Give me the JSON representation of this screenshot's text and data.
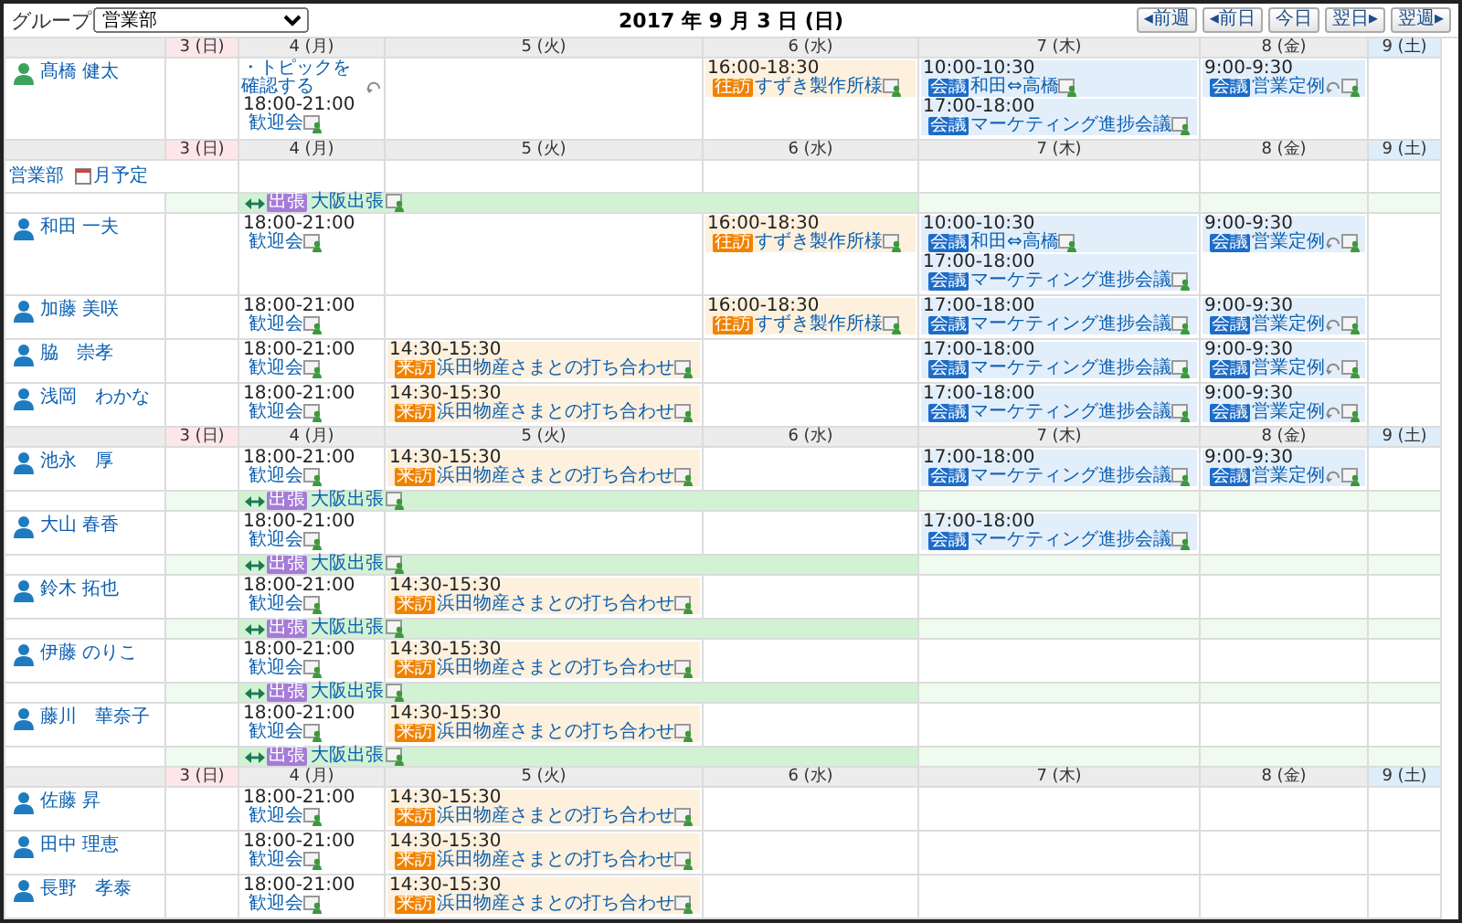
{
  "toolbar": {
    "group_label": "グループ",
    "group_select": "営業部",
    "date_title": "2017 年 9 月 3 日 (日)",
    "nav_buttons": [
      "◂前週",
      "◂前日",
      "今日",
      "翌日▸",
      "翌週▸"
    ]
  },
  "rows": [
    {
      "kind": "header",
      "days": [
        {
          "label": "3 (日)",
          "kind": "sunday"
        },
        {
          "label": "4 (月)",
          "kind": "weekday"
        },
        {
          "label": "5 (火)",
          "kind": "weekday"
        },
        {
          "label": "6 (水)",
          "kind": "weekday"
        },
        {
          "label": "7 (木)",
          "kind": "weekday"
        },
        {
          "label": "8 (金)",
          "kind": "weekday"
        },
        {
          "label": "9 (土)",
          "kind": "saturday"
        }
      ]
    },
    {
      "kind": "user",
      "name": "髙橋 健太",
      "self": true,
      "cells": [
        [],
        [
          {
            "kind": "todo",
            "title": "・トピックを確認する",
            "repeat": true
          },
          {
            "kind": "plain",
            "time": "18:00-21:00",
            "title": "歓迎会",
            "repeat": false
          }
        ],
        [],
        [
          {
            "kind": "visit",
            "time": "16:00-18:30",
            "badge": "往訪",
            "title": "すずき製作所様",
            "repeat": false
          }
        ],
        [
          {
            "kind": "meeting",
            "time": "10:00-10:30",
            "badge": "会議",
            "title": "和田⇔高橋",
            "repeat": false
          },
          {
            "kind": "meeting",
            "time": "17:00-18:00",
            "badge": "会議",
            "title": "マーケティング進捗会議",
            "repeat": false
          }
        ],
        [
          {
            "kind": "meeting",
            "time": "9:00-9:30",
            "badge": "会議",
            "title": "営業定例",
            "repeat": true
          }
        ],
        []
      ]
    },
    {
      "kind": "header",
      "days": [
        {
          "label": "3 (日)",
          "kind": "sunday"
        },
        {
          "label": "4 (月)",
          "kind": "weekday"
        },
        {
          "label": "5 (火)",
          "kind": "weekday"
        },
        {
          "label": "6 (水)",
          "kind": "weekday"
        },
        {
          "label": "7 (木)",
          "kind": "weekday"
        },
        {
          "label": "8 (金)",
          "kind": "weekday"
        },
        {
          "label": "9 (土)",
          "kind": "saturday"
        }
      ]
    },
    {
      "kind": "group",
      "name": "営業部",
      "link": "月予定"
    },
    {
      "kind": "banner",
      "covered": [
        false,
        true,
        true,
        true,
        false,
        false,
        false
      ],
      "badge": "出張",
      "title": "大阪出張"
    },
    {
      "kind": "user",
      "name": "和田 一夫",
      "self": false,
      "cells": [
        [],
        [
          {
            "kind": "plain",
            "time": "18:00-21:00",
            "title": "歓迎会",
            "repeat": false
          }
        ],
        [],
        [
          {
            "kind": "visit",
            "time": "16:00-18:30",
            "badge": "往訪",
            "title": "すずき製作所様",
            "repeat": false
          }
        ],
        [
          {
            "kind": "meeting",
            "time": "10:00-10:30",
            "badge": "会議",
            "title": "和田⇔高橋",
            "repeat": false
          },
          {
            "kind": "meeting",
            "time": "17:00-18:00",
            "badge": "会議",
            "title": "マーケティング進捗会議",
            "repeat": false
          }
        ],
        [
          {
            "kind": "meeting",
            "time": "9:00-9:30",
            "badge": "会議",
            "title": "営業定例",
            "repeat": true
          }
        ],
        []
      ]
    },
    {
      "kind": "user",
      "name": "加藤 美咲",
      "self": false,
      "cells": [
        [],
        [
          {
            "kind": "plain",
            "time": "18:00-21:00",
            "title": "歓迎会",
            "repeat": false
          }
        ],
        [],
        [
          {
            "kind": "visit",
            "time": "16:00-18:30",
            "badge": "往訪",
            "title": "すずき製作所様",
            "repeat": false
          }
        ],
        [
          {
            "kind": "meeting",
            "time": "17:00-18:00",
            "badge": "会議",
            "title": "マーケティング進捗会議",
            "repeat": false
          }
        ],
        [
          {
            "kind": "meeting",
            "time": "9:00-9:30",
            "badge": "会議",
            "title": "営業定例",
            "repeat": true
          }
        ],
        []
      ]
    },
    {
      "kind": "user",
      "name": "脇　崇孝",
      "self": false,
      "cells": [
        [],
        [
          {
            "kind": "plain",
            "time": "18:00-21:00",
            "title": "歓迎会",
            "repeat": false
          }
        ],
        [
          {
            "kind": "visit",
            "time": "14:30-15:30",
            "badge": "来訪",
            "title": "浜田物産さまとの打ち合わせ",
            "repeat": false
          }
        ],
        [],
        [
          {
            "kind": "meeting",
            "time": "17:00-18:00",
            "badge": "会議",
            "title": "マーケティング進捗会議",
            "repeat": false
          }
        ],
        [
          {
            "kind": "meeting",
            "time": "9:00-9:30",
            "badge": "会議",
            "title": "営業定例",
            "repeat": true
          }
        ],
        []
      ]
    },
    {
      "kind": "user",
      "name": "浅岡　わかな",
      "self": false,
      "cells": [
        [],
        [
          {
            "kind": "plain",
            "time": "18:00-21:00",
            "title": "歓迎会",
            "repeat": false
          }
        ],
        [
          {
            "kind": "visit",
            "time": "14:30-15:30",
            "badge": "来訪",
            "title": "浜田物産さまとの打ち合わせ",
            "repeat": false
          }
        ],
        [],
        [
          {
            "kind": "meeting",
            "time": "17:00-18:00",
            "badge": "会議",
            "title": "マーケティング進捗会議",
            "repeat": false
          }
        ],
        [
          {
            "kind": "meeting",
            "time": "9:00-9:30",
            "badge": "会議",
            "title": "営業定例",
            "repeat": true
          }
        ],
        []
      ]
    },
    {
      "kind": "header",
      "days": [
        {
          "label": "3 (日)",
          "kind": "sunday"
        },
        {
          "label": "4 (月)",
          "kind": "weekday"
        },
        {
          "label": "5 (火)",
          "kind": "weekday"
        },
        {
          "label": "6 (水)",
          "kind": "weekday"
        },
        {
          "label": "7 (木)",
          "kind": "weekday"
        },
        {
          "label": "8 (金)",
          "kind": "weekday"
        },
        {
          "label": "9 (土)",
          "kind": "saturday"
        }
      ]
    },
    {
      "kind": "user",
      "name": "池永　厚",
      "self": false,
      "cells": [
        [],
        [
          {
            "kind": "plain",
            "time": "18:00-21:00",
            "title": "歓迎会",
            "repeat": false
          }
        ],
        [
          {
            "kind": "visit",
            "time": "14:30-15:30",
            "badge": "来訪",
            "title": "浜田物産さまとの打ち合わせ",
            "repeat": false
          }
        ],
        [],
        [
          {
            "kind": "meeting",
            "time": "17:00-18:00",
            "badge": "会議",
            "title": "マーケティング進捗会議",
            "repeat": false
          }
        ],
        [
          {
            "kind": "meeting",
            "time": "9:00-9:30",
            "badge": "会議",
            "title": "営業定例",
            "repeat": true
          }
        ],
        []
      ]
    },
    {
      "kind": "banner",
      "covered": [
        false,
        true,
        true,
        true,
        false,
        false,
        false
      ],
      "badge": "出張",
      "title": "大阪出張"
    },
    {
      "kind": "user",
      "name": "大山 春香",
      "self": false,
      "cells": [
        [],
        [
          {
            "kind": "plain",
            "time": "18:00-21:00",
            "title": "歓迎会",
            "repeat": false
          }
        ],
        [],
        [],
        [
          {
            "kind": "meeting",
            "time": "17:00-18:00",
            "badge": "会議",
            "title": "マーケティング進捗会議",
            "repeat": false
          }
        ],
        [],
        []
      ]
    },
    {
      "kind": "banner",
      "covered": [
        false,
        true,
        true,
        true,
        false,
        false,
        false
      ],
      "badge": "出張",
      "title": "大阪出張"
    },
    {
      "kind": "user",
      "name": "鈴木 拓也",
      "self": false,
      "cells": [
        [],
        [
          {
            "kind": "plain",
            "time": "18:00-21:00",
            "title": "歓迎会",
            "repeat": false
          }
        ],
        [
          {
            "kind": "visit",
            "time": "14:30-15:30",
            "badge": "来訪",
            "title": "浜田物産さまとの打ち合わせ",
            "repeat": false
          }
        ],
        [],
        [],
        [],
        []
      ]
    },
    {
      "kind": "banner",
      "covered": [
        false,
        true,
        true,
        true,
        false,
        false,
        false
      ],
      "badge": "出張",
      "title": "大阪出張"
    },
    {
      "kind": "user",
      "name": "伊藤 のりこ",
      "self": false,
      "cells": [
        [],
        [
          {
            "kind": "plain",
            "time": "18:00-21:00",
            "title": "歓迎会",
            "repeat": false
          }
        ],
        [
          {
            "kind": "visit",
            "time": "14:30-15:30",
            "badge": "来訪",
            "title": "浜田物産さまとの打ち合わせ",
            "repeat": false
          }
        ],
        [],
        [],
        [],
        []
      ]
    },
    {
      "kind": "banner",
      "covered": [
        false,
        true,
        true,
        true,
        false,
        false,
        false
      ],
      "badge": "出張",
      "title": "大阪出張"
    },
    {
      "kind": "user",
      "name": "藤川　華奈子",
      "self": false,
      "cells": [
        [],
        [
          {
            "kind": "plain",
            "time": "18:00-21:00",
            "title": "歓迎会",
            "repeat": false
          }
        ],
        [
          {
            "kind": "visit",
            "time": "14:30-15:30",
            "badge": "来訪",
            "title": "浜田物産さまとの打ち合わせ",
            "repeat": false
          }
        ],
        [],
        [],
        [],
        []
      ]
    },
    {
      "kind": "banner",
      "covered": [
        false,
        true,
        true,
        true,
        false,
        false,
        false
      ],
      "badge": "出張",
      "title": "大阪出張"
    },
    {
      "kind": "header",
      "days": [
        {
          "label": "3 (日)",
          "kind": "sunday"
        },
        {
          "label": "4 (月)",
          "kind": "weekday"
        },
        {
          "label": "5 (火)",
          "kind": "weekday"
        },
        {
          "label": "6 (水)",
          "kind": "weekday"
        },
        {
          "label": "7 (木)",
          "kind": "weekday"
        },
        {
          "label": "8 (金)",
          "kind": "weekday"
        },
        {
          "label": "9 (土)",
          "kind": "saturday"
        }
      ]
    },
    {
      "kind": "user",
      "name": "佐藤 昇",
      "self": false,
      "cells": [
        [],
        [
          {
            "kind": "plain",
            "time": "18:00-21:00",
            "title": "歓迎会",
            "repeat": false
          }
        ],
        [
          {
            "kind": "visit",
            "time": "14:30-15:30",
            "badge": "来訪",
            "title": "浜田物産さまとの打ち合わせ",
            "repeat": false
          }
        ],
        [],
        [],
        [],
        []
      ]
    },
    {
      "kind": "user",
      "name": "田中 理恵",
      "self": false,
      "cells": [
        [],
        [
          {
            "kind": "plain",
            "time": "18:00-21:00",
            "title": "歓迎会",
            "repeat": false
          }
        ],
        [
          {
            "kind": "visit",
            "time": "14:30-15:30",
            "badge": "来訪",
            "title": "浜田物産さまとの打ち合わせ",
            "repeat": false
          }
        ],
        [],
        [],
        [],
        []
      ]
    },
    {
      "kind": "user",
      "name": "長野　孝泰",
      "self": false,
      "cells": [
        [],
        [
          {
            "kind": "plain",
            "time": "18:00-21:00",
            "title": "歓迎会",
            "repeat": false
          }
        ],
        [
          {
            "kind": "visit",
            "time": "14:30-15:30",
            "badge": "来訪",
            "title": "浜田物産さまとの打ち合わせ",
            "repeat": false
          }
        ],
        [],
        [],
        [],
        []
      ]
    }
  ]
}
